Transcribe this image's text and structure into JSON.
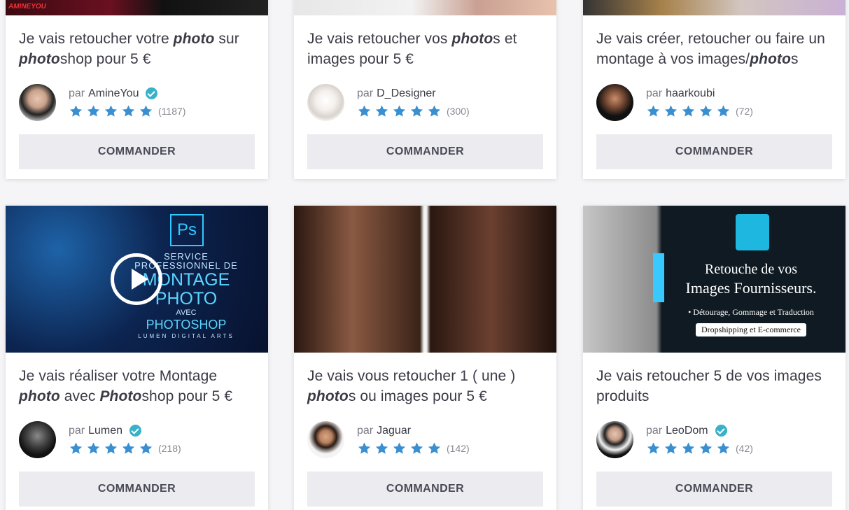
{
  "cta_label": "COMMANDER",
  "by_label": "par",
  "colors": {
    "star": "#3a8fd1",
    "verified": "#38b2c8",
    "cta_bg": "#ebebf0"
  },
  "thumbnails": {
    "lumen": {
      "badge": "Ps",
      "line1": "SERVICE",
      "line2": "PROFESSIONNEL DE",
      "line3": "MONTAGE",
      "line4": "PHOTO",
      "line5": "AVEC",
      "line6": "PHOTOSHOP",
      "line7": "LUMEN DIGITAL ARTS"
    },
    "leodom": {
      "line1": "Retouche de vos",
      "line2": "Images Fournisseurs.",
      "line3": "• Détourage, Gommage et Traduction",
      "line4": "Dropshipping et E-commerce"
    },
    "aminelogo": "AMINEYOU"
  },
  "gigs": [
    {
      "title_parts": [
        "Je vais retoucher votre ",
        "photo",
        " sur ",
        "photo",
        "shop pour 5 €"
      ],
      "seller": "AmineYou",
      "verified": true,
      "rating": 5,
      "reviews": "(1187)"
    },
    {
      "title_parts": [
        "Je vais retoucher vos ",
        "photo",
        "s et images pour 5 €"
      ],
      "seller": "D_Designer",
      "verified": false,
      "rating": 5,
      "reviews": "(300)"
    },
    {
      "title_parts": [
        "Je vais créer, retoucher ou faire un montage à vos images/",
        "photo",
        "s"
      ],
      "seller": "haarkoubi",
      "verified": false,
      "rating": 5,
      "reviews": "(72)"
    },
    {
      "title_parts": [
        "Je vais réaliser votre Montage ",
        "photo",
        " avec ",
        "Photo",
        "shop pour 5 €"
      ],
      "seller": "Lumen",
      "verified": true,
      "rating": 5,
      "reviews": "(218)"
    },
    {
      "title_parts": [
        "Je vais vous retoucher 1 ( une ) ",
        "photo",
        "s ou images pour 5 €"
      ],
      "seller": "Jaguar",
      "verified": false,
      "rating": 5,
      "reviews": "(142)"
    },
    {
      "title_parts": [
        "Je vais retoucher 5 de vos images produits"
      ],
      "seller": "LeoDom",
      "verified": true,
      "rating": 5,
      "reviews": "(42)"
    }
  ]
}
